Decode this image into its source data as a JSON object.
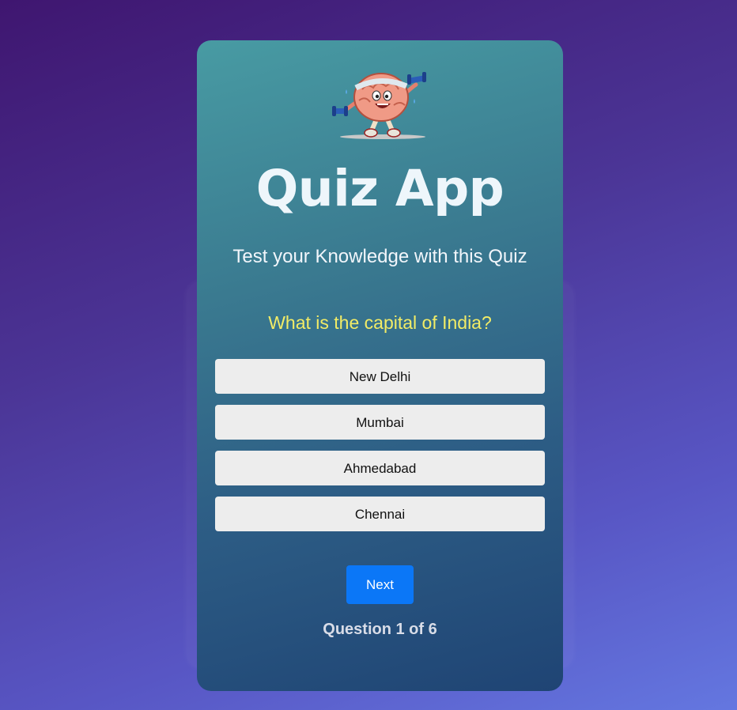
{
  "app": {
    "title": "Quiz App",
    "subtitle": "Test your Knowledge with this Quiz",
    "logo_icon": "brain-mascot-icon"
  },
  "quiz": {
    "question": "What is the capital of India?",
    "answers": [
      "New Delhi",
      "Mumbai",
      "Ahmedabad",
      "Chennai"
    ],
    "next_label": "Next",
    "progress_text": "Question 1 of 6",
    "current_question": 1,
    "total_questions": 6
  },
  "colors": {
    "question_text": "#f2ec66",
    "next_button": "#0b77f7",
    "answer_button": "#ededed"
  }
}
